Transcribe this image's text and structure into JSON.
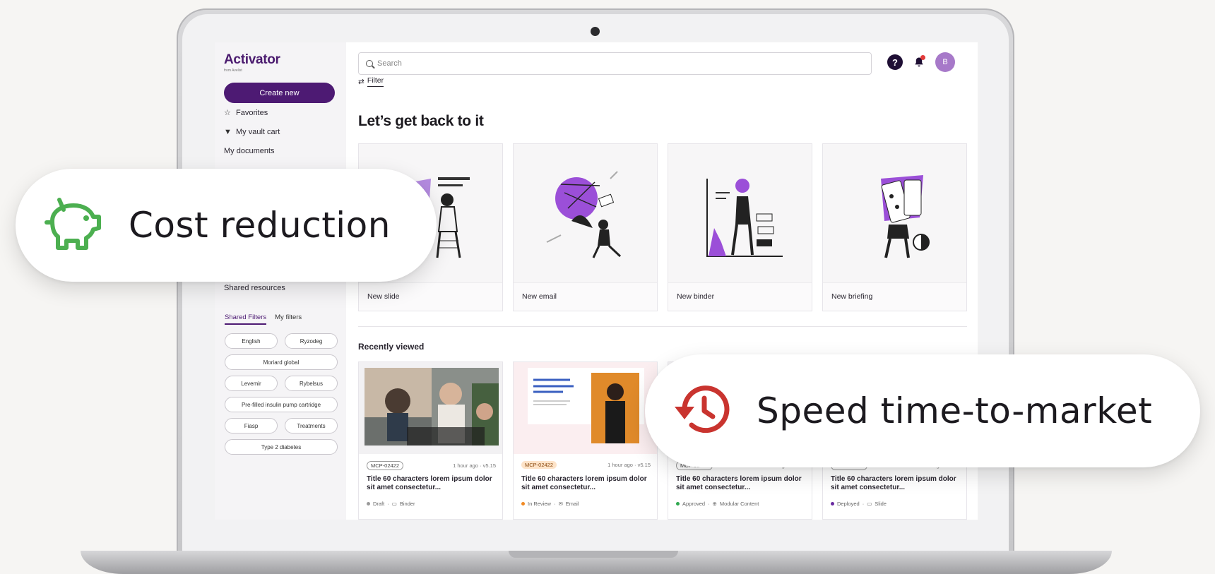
{
  "app": {
    "logo": "Activator",
    "logo_sub": "from Avelist"
  },
  "sidebar": {
    "create_button": "Create new",
    "items": [
      {
        "label": "Favorites",
        "icon": "star-icon"
      },
      {
        "label": "My vault cart",
        "icon": "funnel-icon"
      },
      {
        "label": "My documents",
        "icon": ""
      }
    ],
    "shared_resources": "Shared resources",
    "filter_tabs": [
      "Shared Filters",
      "My filters"
    ],
    "chips": [
      "English",
      "Ryzodeg",
      "Moriard global",
      "Levemir",
      "Rybelsus",
      "Pre-filled insulin pump cartridge",
      "Fiasp",
      "Treatments",
      "Type 2 diabetes"
    ]
  },
  "header": {
    "search_placeholder": "Search",
    "filter_label": "Filter",
    "avatar_initial": "B",
    "help_glyph": "?"
  },
  "main": {
    "greeting": "Let’s get back to it",
    "tiles": [
      {
        "label": "New slide"
      },
      {
        "label": "New email"
      },
      {
        "label": "New binder"
      },
      {
        "label": "New briefing"
      }
    ],
    "recent_title": "Recently viewed",
    "cards": [
      {
        "id": "MCP-02422",
        "time": "1 hour ago · v5.15",
        "title": "Title 60 characters lorem ipsum dolor sit amet consectetur...",
        "status": "Draft",
        "type": "Binder",
        "status_color": "#9a9a9a"
      },
      {
        "id": "MCP-02422",
        "time": "1 hour ago · v5.15",
        "title": "Title 60 characters lorem ipsum dolor sit amet consectetur...",
        "status": "In Review",
        "type": "Email",
        "status_color": "#f08a24"
      },
      {
        "id": "MCP-02422",
        "time": "1 hour ago · v5.15",
        "title": "Title 60 characters lorem ipsum dolor sit amet consectetur...",
        "status": "Approved",
        "type": "Modular Content",
        "status_color": "#2fa84f"
      },
      {
        "id": "MCP-02422",
        "time": "1 hour ago · v5.15",
        "title": "Title 60 characters lorem ipsum dolor sit amet consectetur...",
        "status": "Deployed",
        "type": "Slide",
        "status_color": "#6a2aa0"
      }
    ]
  },
  "callouts": {
    "cost": {
      "text": "Cost reduction",
      "icon": "piggy-bank-icon",
      "color": "#4caf50"
    },
    "speed": {
      "text": "Speed time-to-market",
      "icon": "history-clock-icon",
      "color": "#c9342f"
    }
  },
  "colors": {
    "brand": "#4d1a73",
    "background": "#f6f5f3"
  }
}
